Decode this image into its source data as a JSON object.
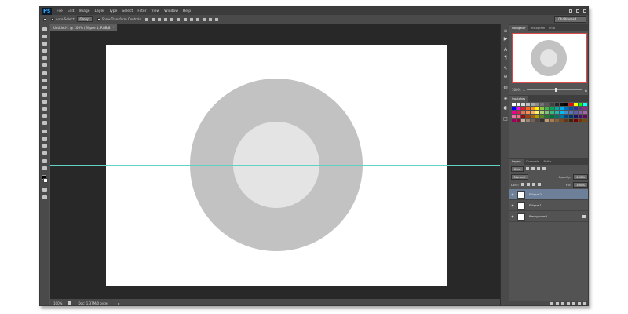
{
  "app": {
    "logo": "Ps",
    "menu": [
      "File",
      "Edit",
      "Image",
      "Layer",
      "Type",
      "Select",
      "Filter",
      "View",
      "Window",
      "Help"
    ]
  },
  "options_bar": {
    "auto_select_label": "Auto-Select:",
    "auto_select_value": "Group",
    "show_transform_label": "Show Transform Controls",
    "workspace": "Chalkboard"
  },
  "document": {
    "tab_title": "Untitled-1 @ 100% (Ellipse 1, RGB/8) *",
    "canvas_color": "#ffffff",
    "outer_circle_color": "#c2c2c2",
    "inner_circle_color": "#e4e4e4",
    "guide_color": "#5fd3c5"
  },
  "status_bar": {
    "zoom": "100%",
    "doc_info": "Doc: 1.37M/0 bytes"
  },
  "navigator": {
    "tabs": [
      "Navigator",
      "Histogram",
      "Info"
    ],
    "zoom": "100%"
  },
  "swatches": {
    "tabs": [
      "Swatches"
    ],
    "colors": [
      "#ffffff",
      "#f2f2f2",
      "#d9d9d9",
      "#bfbfbf",
      "#a6a6a6",
      "#8c8c8c",
      "#737373",
      "#595959",
      "#404040",
      "#262626",
      "#0d0d0d",
      "#000000",
      "#ff0000",
      "#ffff00",
      "#00ff00",
      "#00ffff",
      "#0000ff",
      "#ff00ff",
      "#ed1c24",
      "#f26522",
      "#f7941d",
      "#fff200",
      "#8dc63f",
      "#39b54a",
      "#00a651",
      "#00a99d",
      "#00aeef",
      "#0072bc",
      "#0054a6",
      "#2e3192",
      "#662d91",
      "#92278f",
      "#ec008c",
      "#ed145b",
      "#f26c4f",
      "#f68e56",
      "#fbaf5d",
      "#fff568",
      "#acd373",
      "#7cc576",
      "#3bb878",
      "#1abbb4",
      "#00bff3",
      "#438ccb",
      "#5574b9",
      "#605ca8",
      "#8560a8",
      "#a864a8",
      "#f06eaa",
      "#f26d7d",
      "#9e0b0f",
      "#a0410d",
      "#a36209",
      "#aba000",
      "#598527",
      "#1a7b30",
      "#007236",
      "#00746b",
      "#0076a3",
      "#004a80",
      "#003471",
      "#1b1464",
      "#440e62",
      "#630460",
      "#9e005d",
      "#9e0039",
      "#c7b299",
      "#998675",
      "#736357",
      "#534741",
      "#37302d",
      "#c69c6d",
      "#a67c52",
      "#8c6239",
      "#754c24",
      "#603913",
      "#42210b",
      "#790000",
      "#7b2e00",
      "#7d4900"
    ]
  },
  "layers": {
    "tabs": [
      "Layers",
      "Channels",
      "Paths"
    ],
    "filter_kind": "Kind",
    "blend_mode": "Normal",
    "opacity_label": "Opacity:",
    "opacity_value": "100%",
    "lock_label": "Lock:",
    "fill_label": "Fill:",
    "fill_value": "100%",
    "items": [
      {
        "name": "Ellipse 2",
        "selected": true
      },
      {
        "name": "Ellipse 1",
        "selected": false
      },
      {
        "name": "Background",
        "selected": false
      }
    ]
  }
}
